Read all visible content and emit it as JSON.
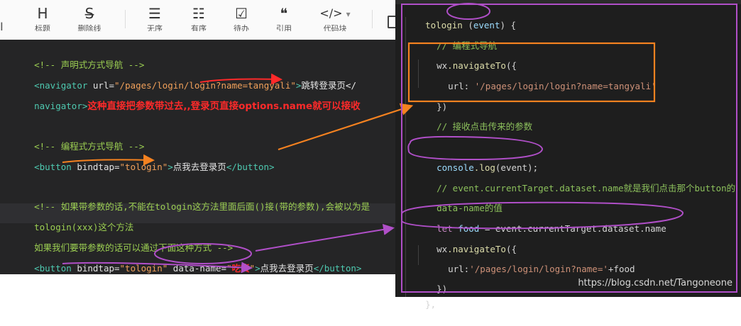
{
  "toolbar": {
    "buttons": [
      {
        "glyph": "H",
        "caption": "标题"
      },
      {
        "glyph": "S̶",
        "caption": "删除线"
      },
      {
        "glyph": "☰",
        "caption": "无序"
      },
      {
        "glyph": "☷",
        "caption": "有序"
      },
      {
        "glyph": "☑",
        "caption": "待办"
      },
      {
        "glyph": "❝",
        "caption": "引用"
      },
      {
        "glyph": "</>",
        "caption": "代码块"
      }
    ],
    "left_glyph": "I",
    "dropdown_glyph": "▾"
  },
  "left_code": {
    "line1": "<!-- 声明式方式导航 -->",
    "line2_open": "<navigator",
    "line2_attr": " url=",
    "line2_str": "\"/pages/login/login?name=tangyali\"",
    "line2_gt": ">",
    "line2_text": "跳转登录页</",
    "line3_tag": "navigator>",
    "line3_note": "这种直接把参数带过去,,登录页直接options.name就可以接收",
    "line4": "<!-- 编程式方式导航 -->",
    "line5_open": "<button",
    "line5_attr": " bindtap=",
    "line5_str": "\"tologin\"",
    "line5_gt": ">",
    "line5_text": "点我去登录页",
    "line5_close": "</button>",
    "line6": "<!-- 如果带参数的话,不能在tologin这方法里面后面()接(带的参数),会被以为是",
    "line7": "tologin(xxx)这个方法",
    "line8": "如果我们要带参数的话可以通过下面这种方式 -->",
    "line9_open": "<button",
    "line9_attr1": " bindtap=",
    "line9_str1": "\"tologin\"",
    "line9_attr2": " data-name=",
    "line9_str2_q1": "\"",
    "line9_str2_val": "吃货",
    "line9_str2_q2": "\"",
    "line9_gt": ">",
    "line9_text": "点我去登录页",
    "line9_close": "</button>"
  },
  "right_code": {
    "l1_fn": "tologin",
    "l1_open": " (",
    "l1_arg": "event",
    "l1_close": ") {",
    "l2": "// 编程式导航",
    "l3_obj": "wx",
    "l3_fn": ".navigateTo",
    "l3_open": "({",
    "l4_key": "url: ",
    "l4_str": "'/pages/login/login?name=tangyali'",
    "l5": "})",
    "l6": "// 接收点击传来的参数",
    "l7_obj": "console",
    "l7_fn": ".log",
    "l7_rest": "(event);",
    "l8": "// event.currentTarget.dataset.name就是我们点击那个button的",
    "l9": "data-name的值",
    "l10_kw": "let",
    "l10_var": " food",
    "l10_rest": " = event.currentTarget.dataset.name",
    "l11_obj": "wx",
    "l11_fn": ".navigateTo",
    "l11_open": "({",
    "l12_key": "url:",
    "l12_str": "'/pages/login/login?name='",
    "l12_rest": "+food",
    "l13": "})",
    "l14": "},"
  },
  "watermark": "https://blog.csdn.net/Tangoneone",
  "colors": {
    "annotation_red": "#ff2a2a",
    "annotation_orange": "#f58220",
    "annotation_purple": "#b04fc8"
  }
}
